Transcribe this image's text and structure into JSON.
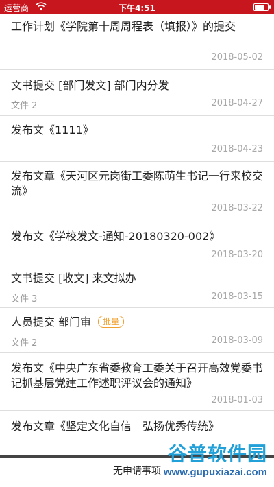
{
  "status_bar": {
    "carrier": "运营商",
    "time": "下午4:51",
    "battery_level": 0.9
  },
  "items": [
    {
      "title": "工作计划《学院第十周周程表（填报）》的提交",
      "sub": "",
      "badge": "",
      "date": "2018-05-02"
    },
    {
      "title": "文书提交 [部门发文] 部门内分发",
      "sub": "文件 2",
      "badge": "",
      "date": "2018-04-27"
    },
    {
      "title": " 发布文《1111》",
      "sub": "",
      "badge": "",
      "date": "2018-04-23"
    },
    {
      "title": " 发布文章《天河区元岗街工委陈萌生书记一行来校交流》",
      "sub": "",
      "badge": "",
      "date": "2018-03-22"
    },
    {
      "title": " 发布文《学校发文-通知-20180320-002》",
      "sub": "",
      "badge": "",
      "date": "2018-03-20"
    },
    {
      "title": "文书提交 [收文] 来文拟办",
      "sub": "文件 3",
      "badge": "",
      "date": "2018-03-15"
    },
    {
      "title": "人员提交 部门审",
      "sub": "文件 2",
      "badge": "批量",
      "date": "2018-03-09"
    },
    {
      "title": " 发布文《中央广东省委教育工委关于召开高效党委书记抓基层党建工作述职评议会的通知》",
      "sub": "",
      "badge": "",
      "date": "2018-01-03"
    },
    {
      "title": " 发布文章《坚定文化自信　弘扬优秀传统》",
      "sub": "",
      "badge": "",
      "date": ""
    }
  ],
  "footer": {
    "label": "无申请事项"
  },
  "watermark": {
    "cn": "谷普软件园",
    "url": "www.gupuxiazai.com"
  }
}
